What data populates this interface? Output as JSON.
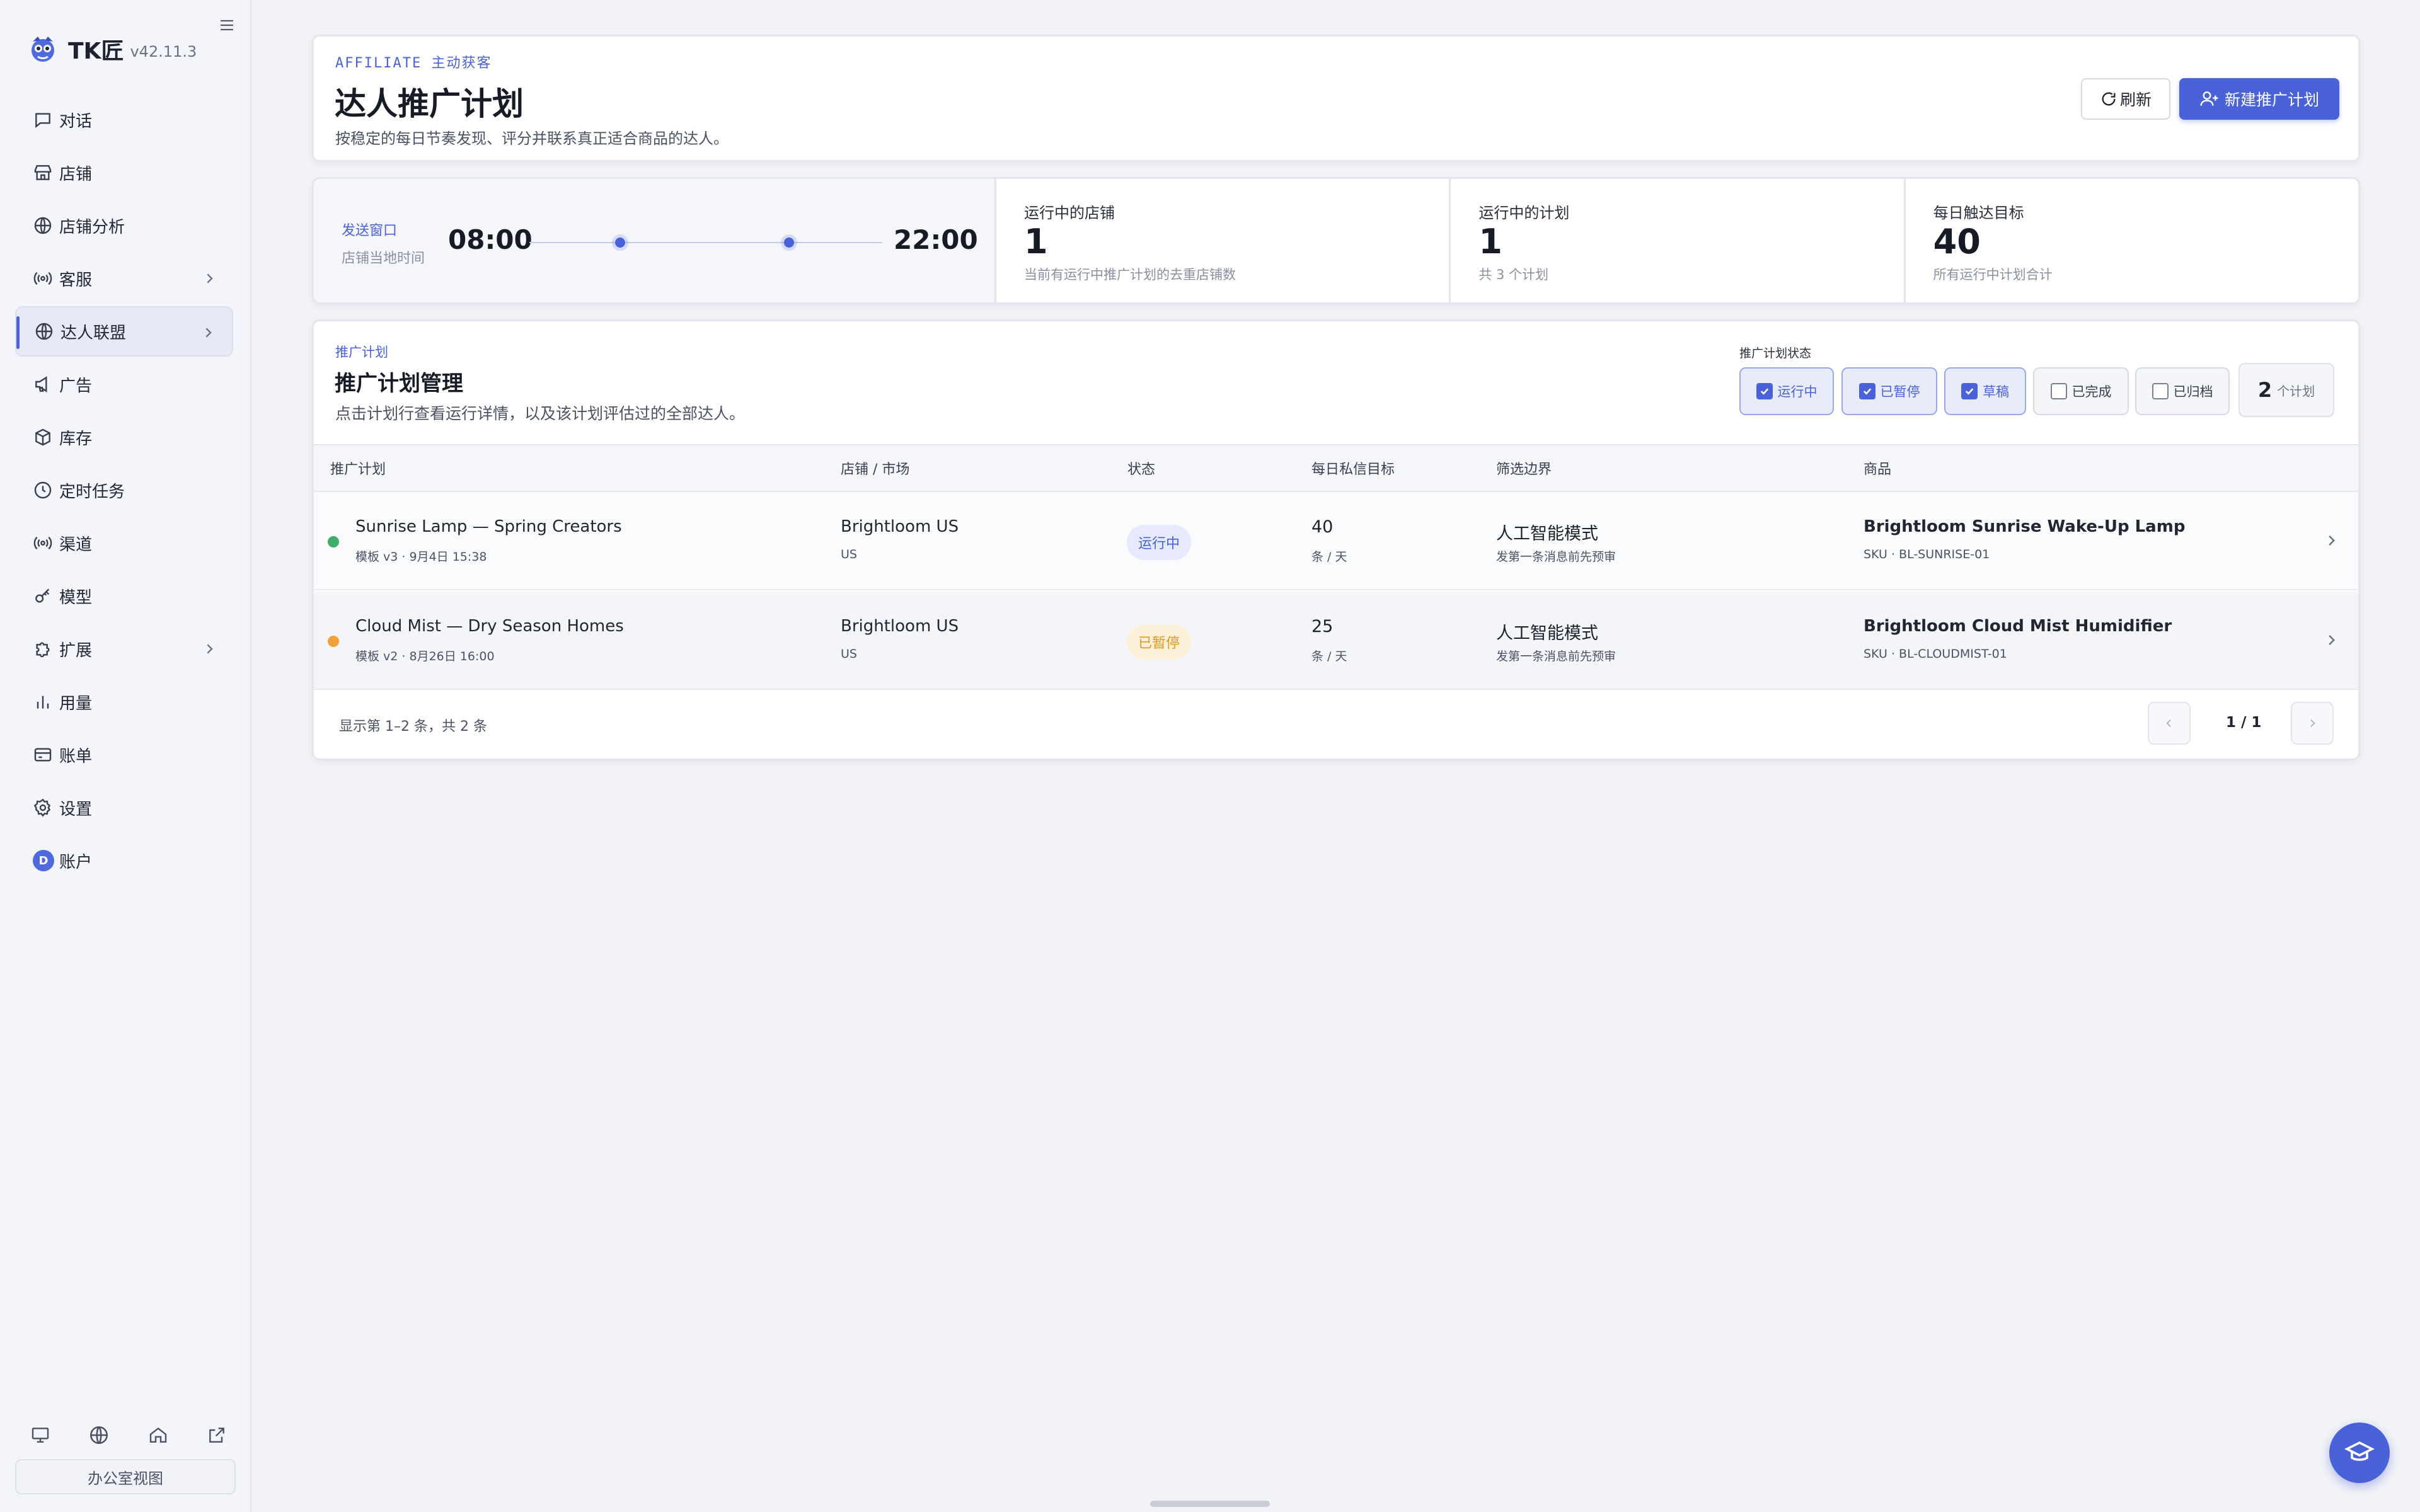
{
  "app": {
    "name": "TK匠",
    "version": "v42.11.3"
  },
  "sidebar": {
    "items": [
      {
        "label": "对话",
        "icon": "chat-icon"
      },
      {
        "label": "店铺",
        "icon": "store-icon"
      },
      {
        "label": "店铺分析",
        "icon": "globe-icon"
      },
      {
        "label": "客服",
        "icon": "broadcast-icon",
        "has_submenu": true
      },
      {
        "label": "达人联盟",
        "icon": "globe-icon",
        "has_submenu": true,
        "active": true
      },
      {
        "label": "广告",
        "icon": "megaphone-icon"
      },
      {
        "label": "库存",
        "icon": "box-icon"
      },
      {
        "label": "定时任务",
        "icon": "clock-icon"
      },
      {
        "label": "渠道",
        "icon": "broadcast-icon"
      },
      {
        "label": "模型",
        "icon": "key-icon"
      },
      {
        "label": "扩展",
        "icon": "puzzle-icon",
        "has_submenu": true
      },
      {
        "label": "用量",
        "icon": "bar-chart-icon"
      },
      {
        "label": "账单",
        "icon": "credit-card-icon"
      },
      {
        "label": "设置",
        "icon": "gear-icon"
      },
      {
        "label": "账户",
        "icon": "avatar",
        "avatar_letter": "D"
      }
    ],
    "bottom_icons": [
      "monitor-icon",
      "globe-icon",
      "home-icon",
      "external-link-icon"
    ],
    "office_view_label": "办公室视图"
  },
  "header": {
    "eyebrow": "AFFILIATE 主动获客",
    "title": "达人推广计划",
    "subtitle": "按稳定的每日节奏发现、评分并联系真正适合商品的达人。",
    "refresh_label": "刷新",
    "new_plan_label": "新建推广计划"
  },
  "stats": {
    "send_window": {
      "label": "发送窗口",
      "sub": "店铺当地时间",
      "start": "08:00",
      "end": "22:00"
    },
    "cards": [
      {
        "label": "运行中的店铺",
        "value": "1",
        "sub": "当前有运行中推广计划的去重店铺数"
      },
      {
        "label": "运行中的计划",
        "value": "1",
        "sub": "共 3 个计划"
      },
      {
        "label": "每日触达目标",
        "value": "40",
        "sub": "所有运行中计划合计"
      }
    ]
  },
  "plans": {
    "eyebrow": "推广计划",
    "title": "推广计划管理",
    "subtitle": "点击计划行查看运行详情，以及该计划评估过的全部达人。",
    "filter_label": "推广计划状态",
    "filters": [
      {
        "label": "运行中",
        "checked": true
      },
      {
        "label": "已暂停",
        "checked": true
      },
      {
        "label": "草稿",
        "checked": true
      },
      {
        "label": "已完成",
        "checked": false
      },
      {
        "label": "已归档",
        "checked": false
      }
    ],
    "count": "2",
    "count_unit": "个计划",
    "columns": [
      "推广计划",
      "店铺 / 市场",
      "状态",
      "每日私信目标",
      "筛选边界",
      "商品"
    ],
    "rows": [
      {
        "name": "Sunrise Lamp — Spring Creators",
        "meta": "模板 v3 · 9月4日 15:38",
        "store": "Brightloom US",
        "market": "US",
        "status": "运行中",
        "status_color": "#3fae6a",
        "target": "40",
        "target_unit": "条 / 天",
        "boundary": "人工智能模式",
        "boundary_sub": "发第一条消息前先预审",
        "product": "Brightloom Sunrise Wake-Up Lamp",
        "sku": "SKU · BL-SUNRISE-01"
      },
      {
        "name": "Cloud Mist — Dry Season Homes",
        "meta": "模板 v2 · 8月26日 16:00",
        "store": "Brightloom US",
        "market": "US",
        "status": "已暂停",
        "status_color": "#f0a23a",
        "target": "25",
        "target_unit": "条 / 天",
        "boundary": "人工智能模式",
        "boundary_sub": "发第一条消息前先预审",
        "product": "Brightloom Cloud Mist Humidifier",
        "sku": "SKU · BL-CLOUDMIST-01"
      }
    ],
    "footer": "显示第 1–2 条，共 2 条",
    "page": "1 / 1"
  }
}
